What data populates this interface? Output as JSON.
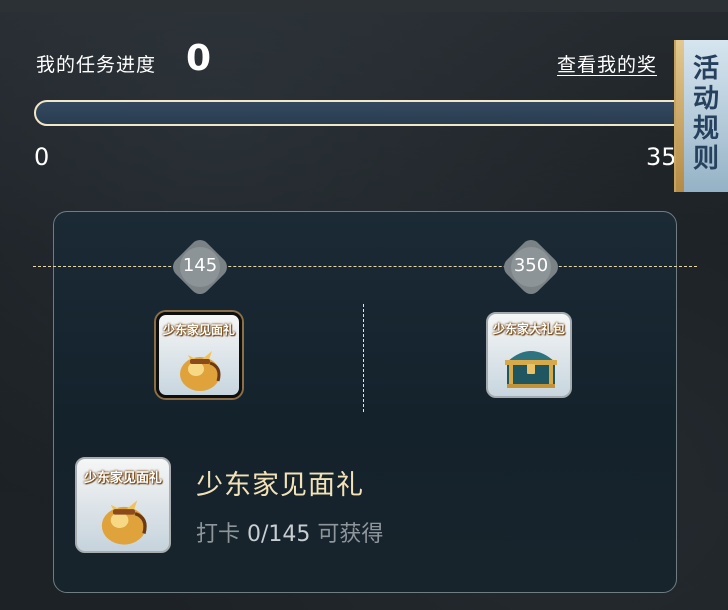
{
  "header": {
    "progress_title": "我的任务进度",
    "progress_value": "0",
    "rewards_link": "查看我的奖",
    "progress_min": "0",
    "progress_max": "35",
    "progress_fraction": 0
  },
  "rules_tab": {
    "label": "活动规则"
  },
  "milestones": [
    {
      "value": "145"
    },
    {
      "value": "350"
    }
  ],
  "rewards": [
    {
      "name": "少东家见面礼",
      "icon": "gold-pouch-icon",
      "selected": true
    },
    {
      "name": "少东家大礼包",
      "icon": "treasure-chest-icon",
      "selected": false
    }
  ],
  "detail": {
    "icon_label": "少东家见面礼",
    "title": "少东家见面礼",
    "prefix": "打卡",
    "count": "0/145",
    "suffix": "可获得"
  },
  "colors": {
    "accent_gold": "#f2e2b6",
    "track_fill": "#2a3d51",
    "track_border": "#f1e7c6"
  }
}
